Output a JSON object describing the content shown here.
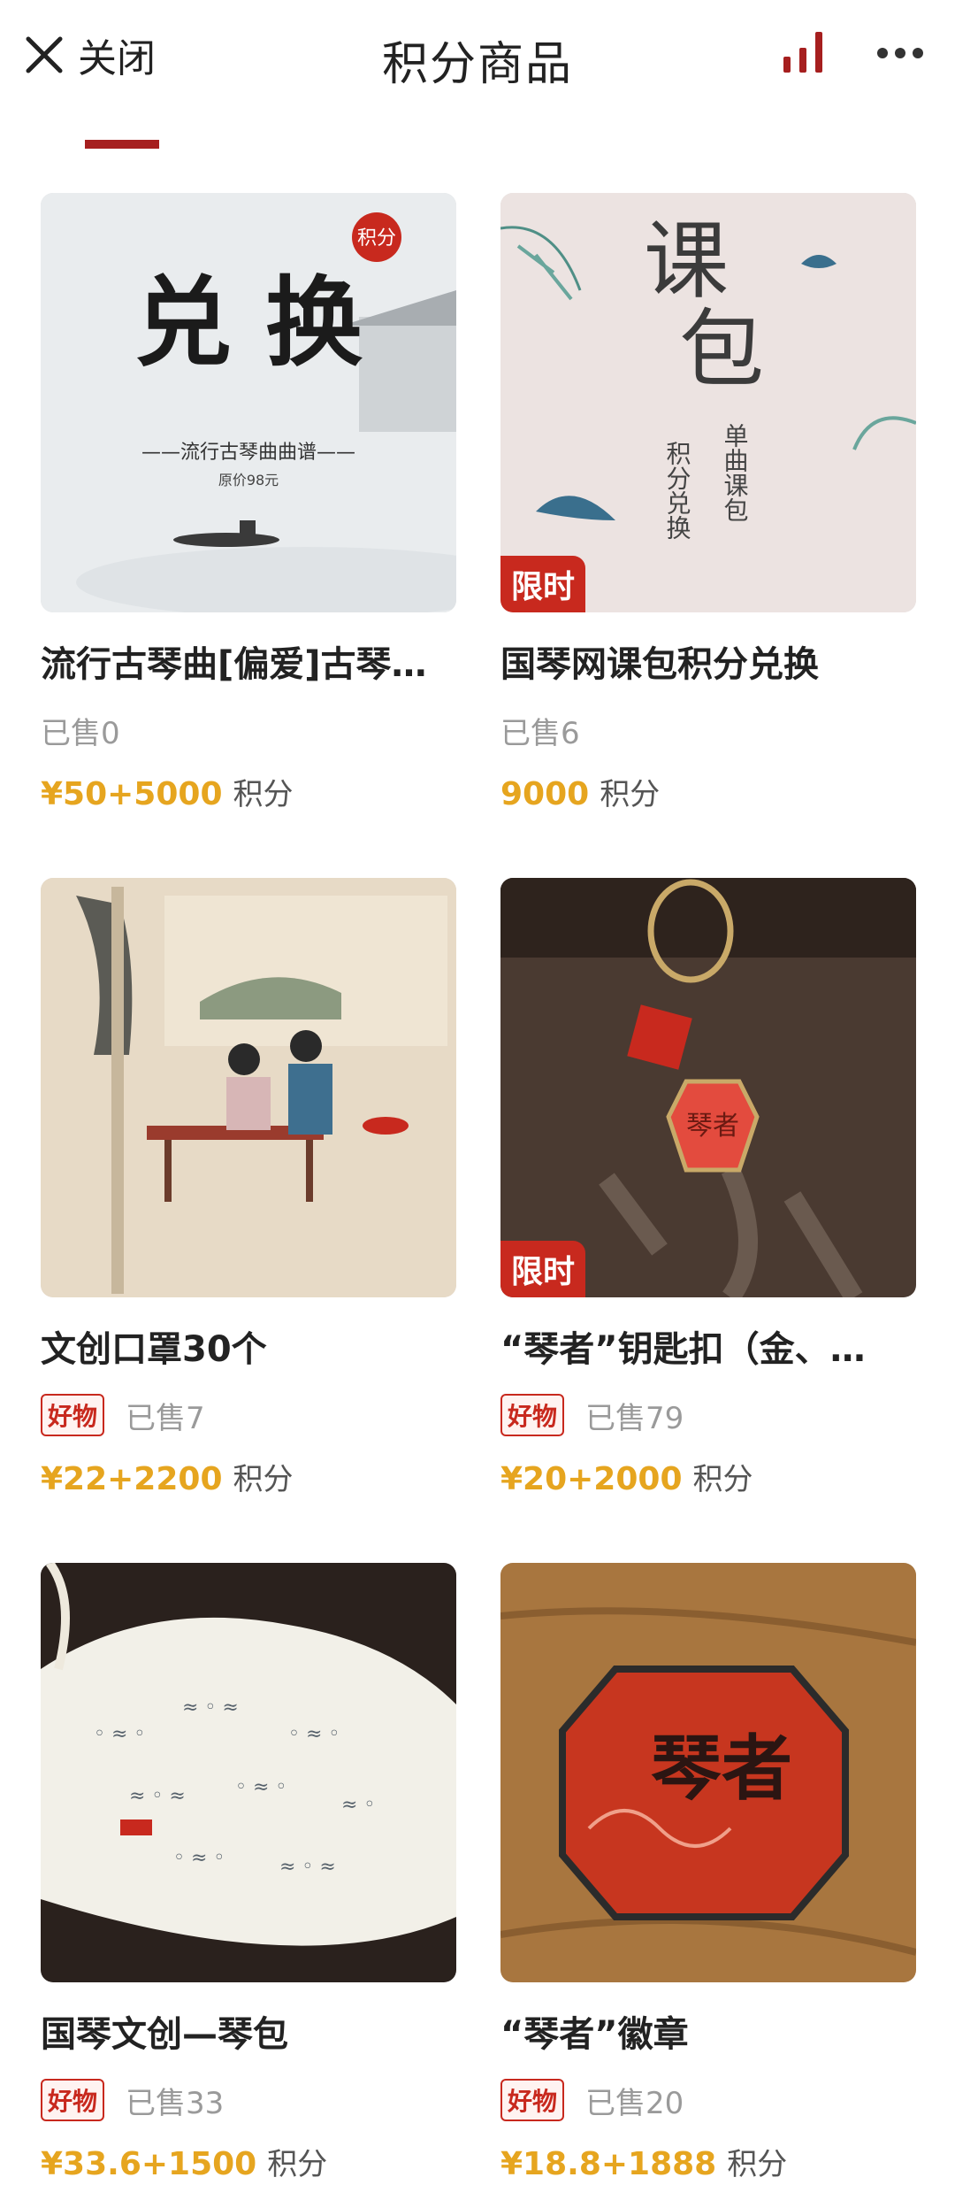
{
  "header": {
    "close_label": "关闭",
    "title": "积分商品"
  },
  "colors": {
    "accent": "#a61f1f",
    "badge_red": "#c8291e",
    "price_gold": "#e6a51f"
  },
  "products": [
    {
      "title": "流行古琴曲[偏爱]古琴…",
      "image_text": {
        "main": "兑 换",
        "line": "——流行古琴曲曲谱——",
        "sub": "原价98元",
        "seal": "积分"
      },
      "limited": "",
      "good_badge": "",
      "sold": "已售0",
      "price": "¥50+5000",
      "points_word": "积分"
    },
    {
      "title": "国琴网课包积分兑换",
      "image_text": {
        "main1": "课",
        "main2": "包",
        "col1": "积分兑换",
        "col2": "单曲课包"
      },
      "limited": "限时",
      "good_badge": "",
      "sold": "已售6",
      "price": "9000",
      "points_word": "积分"
    },
    {
      "title": "文创口罩30个",
      "limited": "",
      "good_badge": "好物",
      "sold": "已售7",
      "price": "¥22+2200",
      "points_word": "积分"
    },
    {
      "title": "“琴者”钥匙扣（金、…",
      "image_text": {
        "tag": "琴者"
      },
      "limited": "限时",
      "good_badge": "好物",
      "sold": "已售79",
      "price": "¥20+2000",
      "points_word": "积分"
    },
    {
      "title": "国琴文创—琴包",
      "limited": "",
      "good_badge": "好物",
      "sold": "已售33",
      "price": "¥33.6+1500",
      "points_word": "积分"
    },
    {
      "title": "“琴者”徽章",
      "image_text": {
        "tag": "琴者"
      },
      "limited": "",
      "good_badge": "好物",
      "sold": "已售20",
      "price": "¥18.8+1888",
      "points_word": "积分"
    }
  ]
}
